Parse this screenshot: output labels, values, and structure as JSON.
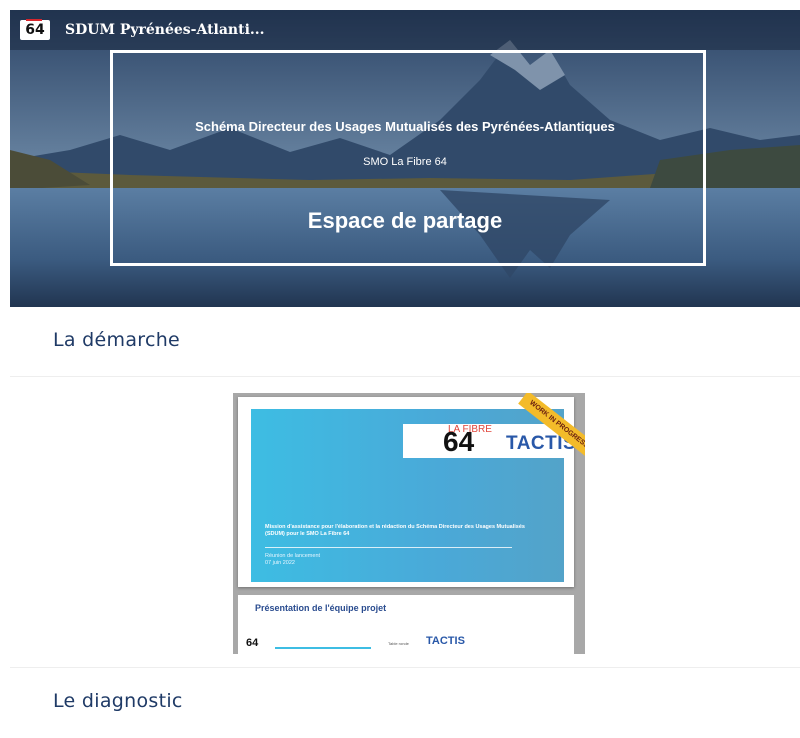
{
  "header": {
    "logo_text": "64",
    "site_title": "SDUM Pyrénées-Atlanti..."
  },
  "hero": {
    "line1": "Schéma Directeur des Usages Mutualisés des Pyrénées-Atlantiques",
    "line2": "SMO La Fibre 64",
    "line3": "Espace de partage"
  },
  "sections": [
    {
      "title": "La démarche"
    },
    {
      "title": "Le diagnostic"
    }
  ],
  "document_preview": {
    "slide1": {
      "logo_fibre": "LA FIBRE",
      "logo_64": "64",
      "logo_tactis": "TACTIS",
      "ribbon": "WORK IN PROGRESS",
      "mission": "Mission d'assistance pour l'élaboration et la rédaction du Schéma Directeur des Usages Mutualisés (SDUM) pour le SMO La Fibre 64",
      "meeting": "Réunion de lancement",
      "date": "07 juin 2022"
    },
    "slide2": {
      "heading": "Présentation de l'équipe projet",
      "logo_64": "64",
      "logo_tactis": "TACTIS",
      "small": "Table ronde"
    }
  },
  "colors": {
    "accent_blue": "#1f3a66",
    "slide_cyan": "#3dbde3",
    "tactis_blue": "#2958a8"
  }
}
